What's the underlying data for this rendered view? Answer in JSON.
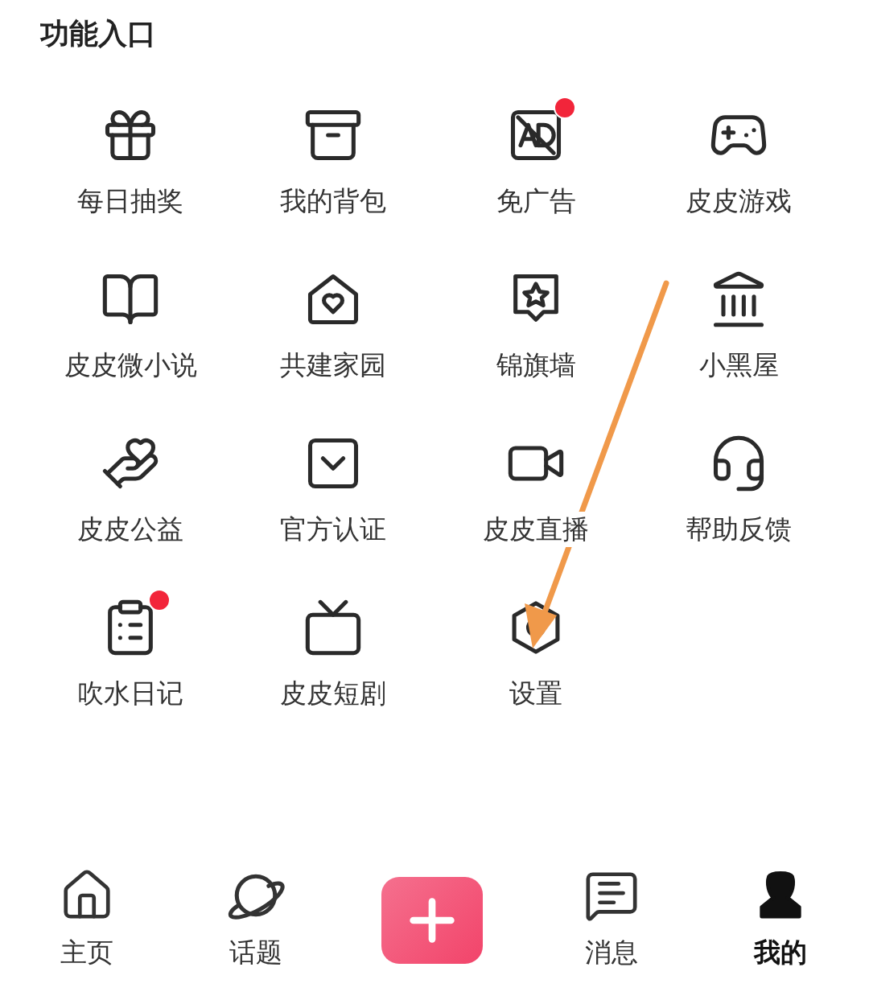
{
  "section": {
    "title": "功能入口"
  },
  "features": [
    {
      "label": "每日抽奖",
      "badge": false
    },
    {
      "label": "我的背包",
      "badge": false
    },
    {
      "label": "免广告",
      "badge": true
    },
    {
      "label": "皮皮游戏",
      "badge": false
    },
    {
      "label": "皮皮微小说",
      "badge": false
    },
    {
      "label": "共建家园",
      "badge": false
    },
    {
      "label": "锦旗墙",
      "badge": false
    },
    {
      "label": "小黑屋",
      "badge": false
    },
    {
      "label": "皮皮公益",
      "badge": false
    },
    {
      "label": "官方认证",
      "badge": false
    },
    {
      "label": "皮皮直播",
      "badge": false
    },
    {
      "label": "帮助反馈",
      "badge": false
    },
    {
      "label": "吹水日记",
      "badge": true
    },
    {
      "label": "皮皮短剧",
      "badge": false
    },
    {
      "label": "设置",
      "badge": false
    }
  ],
  "nav": [
    {
      "kind": "tab",
      "label": "主页",
      "selected": false
    },
    {
      "kind": "tab",
      "label": "话题",
      "selected": false
    },
    {
      "kind": "compose"
    },
    {
      "kind": "tab",
      "label": "消息",
      "selected": false
    },
    {
      "kind": "tab",
      "label": "我的",
      "selected": true
    }
  ],
  "annotation": {
    "kind": "arrow"
  }
}
